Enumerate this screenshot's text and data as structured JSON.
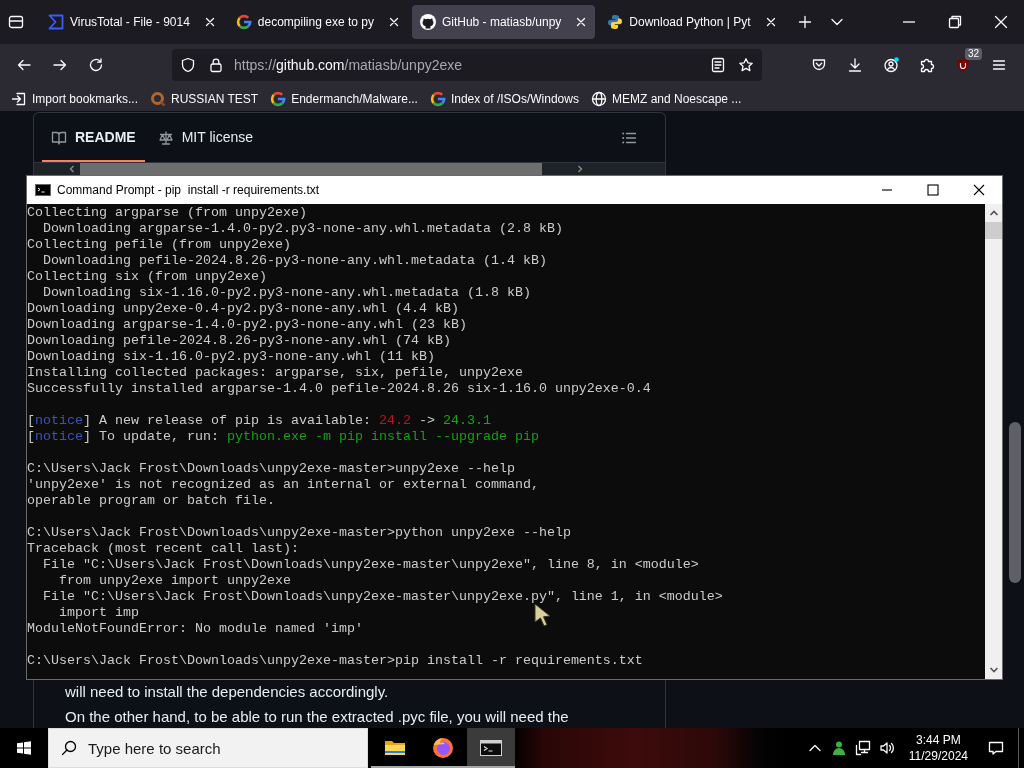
{
  "browser": {
    "tabs": [
      {
        "title": "VirusTotal - File - 9014",
        "kind": "sigma",
        "selected": false
      },
      {
        "title": "decompiling exe to py",
        "kind": "google",
        "selected": false
      },
      {
        "title": "GitHub - matiasb/unpy",
        "kind": "github",
        "selected": true
      },
      {
        "title": "Download Python | Pyt",
        "kind": "python",
        "selected": false
      }
    ],
    "url": {
      "scheme": "https://",
      "host": "github.com",
      "path": "/matiasb/unpy2exe"
    },
    "extension_badge": "32",
    "bookmarks": [
      {
        "label": "Import bookmarks...",
        "kind": "import"
      },
      {
        "label": "RUSSIAN TEST",
        "kind": "site"
      },
      {
        "label": "Endermanch/Malware...",
        "kind": "google"
      },
      {
        "label": "Index of /ISOs/Windows",
        "kind": "google"
      },
      {
        "label": "MEMZ and Noescape ...",
        "kind": "globe"
      }
    ]
  },
  "page": {
    "readme_tabs": [
      {
        "label": "README",
        "kind": "book",
        "selected": true
      },
      {
        "label": "MIT license",
        "kind": "scale",
        "selected": false
      }
    ],
    "paragraphs": [
      "will need to install the dependencies accordingly.",
      "On the other hand, to be able to run the extracted .pyc file, you will need the"
    ]
  },
  "command_prompt": {
    "title": "Command Prompt - pip  install -r requirements.txt",
    "blocks": [
      [
        "Collecting argparse (from unpy2exe)",
        "  Downloading argparse-1.4.0-py2.py3-none-any.whl.metadata (2.8 kB)",
        "Collecting pefile (from unpy2exe)",
        "  Downloading pefile-2024.8.26-py3-none-any.whl.metadata (1.4 kB)",
        "Collecting six (from unpy2exe)",
        "  Downloading six-1.16.0-py2.py3-none-any.whl.metadata (1.8 kB)",
        "Downloading unpy2exe-0.4-py2.py3-none-any.whl (4.4 kB)",
        "Downloading argparse-1.4.0-py2.py3-none-any.whl (23 kB)",
        "Downloading pefile-2024.8.26-py3-none-any.whl (74 kB)",
        "Downloading six-1.16.0-py2.py3-none-any.whl (11 kB)",
        "Installing collected packages: argparse, six, pefile, unpy2exe",
        "Successfully installed argparse-1.4.0 pefile-2024.8.26 six-1.16.0 unpy2exe-0.4"
      ],
      [
        {
          "segments": [
            {
              "text": "[",
              "kind": "plain"
            },
            {
              "text": "notice",
              "kind": "notice"
            },
            {
              "text": "] A new release of pip is available: ",
              "kind": "plain"
            },
            {
              "text": "24.2",
              "kind": "old_version"
            },
            {
              "text": " -> ",
              "kind": "plain"
            },
            {
              "text": "24.3.1",
              "kind": "new_version"
            }
          ]
        },
        {
          "segments": [
            {
              "text": "[",
              "kind": "plain"
            },
            {
              "text": "notice",
              "kind": "notice"
            },
            {
              "text": "] To update, run: ",
              "kind": "plain"
            },
            {
              "text": "python.exe -m pip install --upgrade pip",
              "kind": "command"
            }
          ]
        }
      ],
      [
        "C:\\Users\\Jack Frost\\Downloads\\unpy2exe-master>unpy2exe --help",
        "'unpy2exe' is not recognized as an internal or external command,",
        "operable program or batch file."
      ],
      [
        "C:\\Users\\Jack Frost\\Downloads\\unpy2exe-master>python unpy2exe --help",
        "Traceback (most recent call last):",
        "  File \"C:\\Users\\Jack Frost\\Downloads\\unpy2exe-master\\unpy2exe\", line 8, in <module>",
        "    from unpy2exe import unpy2exe",
        "  File \"C:\\Users\\Jack Frost\\Downloads\\unpy2exe-master\\unpy2exe.py\", line 1, in <module>",
        "    import imp",
        "ModuleNotFoundError: No module named 'imp'"
      ],
      [
        "C:\\Users\\Jack Frost\\Downloads\\unpy2exe-master>pip install -r requirements.txt"
      ]
    ]
  },
  "taskbar": {
    "search": {
      "placeholder": "Type here to search"
    },
    "apps": [
      {
        "kind": "folder",
        "running": true,
        "active": false
      },
      {
        "kind": "firefox",
        "running": true,
        "active": false
      },
      {
        "kind": "terminal",
        "running": true,
        "active": true
      }
    ],
    "clock": {
      "time": "3:44 PM",
      "date": "11/29/2024"
    }
  }
}
